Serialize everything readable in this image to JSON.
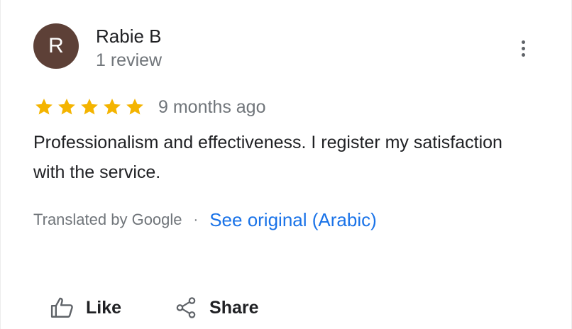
{
  "review": {
    "author": {
      "initial": "R",
      "name": "Rabie B",
      "review_count": "1 review",
      "avatar_color": "#5d4037"
    },
    "rating": {
      "stars": 5,
      "max_stars": 5,
      "star_color": "#f4b400"
    },
    "time_ago": "9 months ago",
    "text": "Professionalism and effectiveness. I register my satisfaction with the service.",
    "translation": {
      "label": "Translated by Google",
      "separator": "·",
      "see_original": "See original (Arabic)",
      "link_color": "#1a73e8"
    }
  },
  "actions": {
    "like_label": "Like",
    "share_label": "Share"
  },
  "icons": {
    "more": "more-vertical-icon",
    "like": "thumbs-up-icon",
    "share": "share-icon",
    "star": "star-icon"
  }
}
